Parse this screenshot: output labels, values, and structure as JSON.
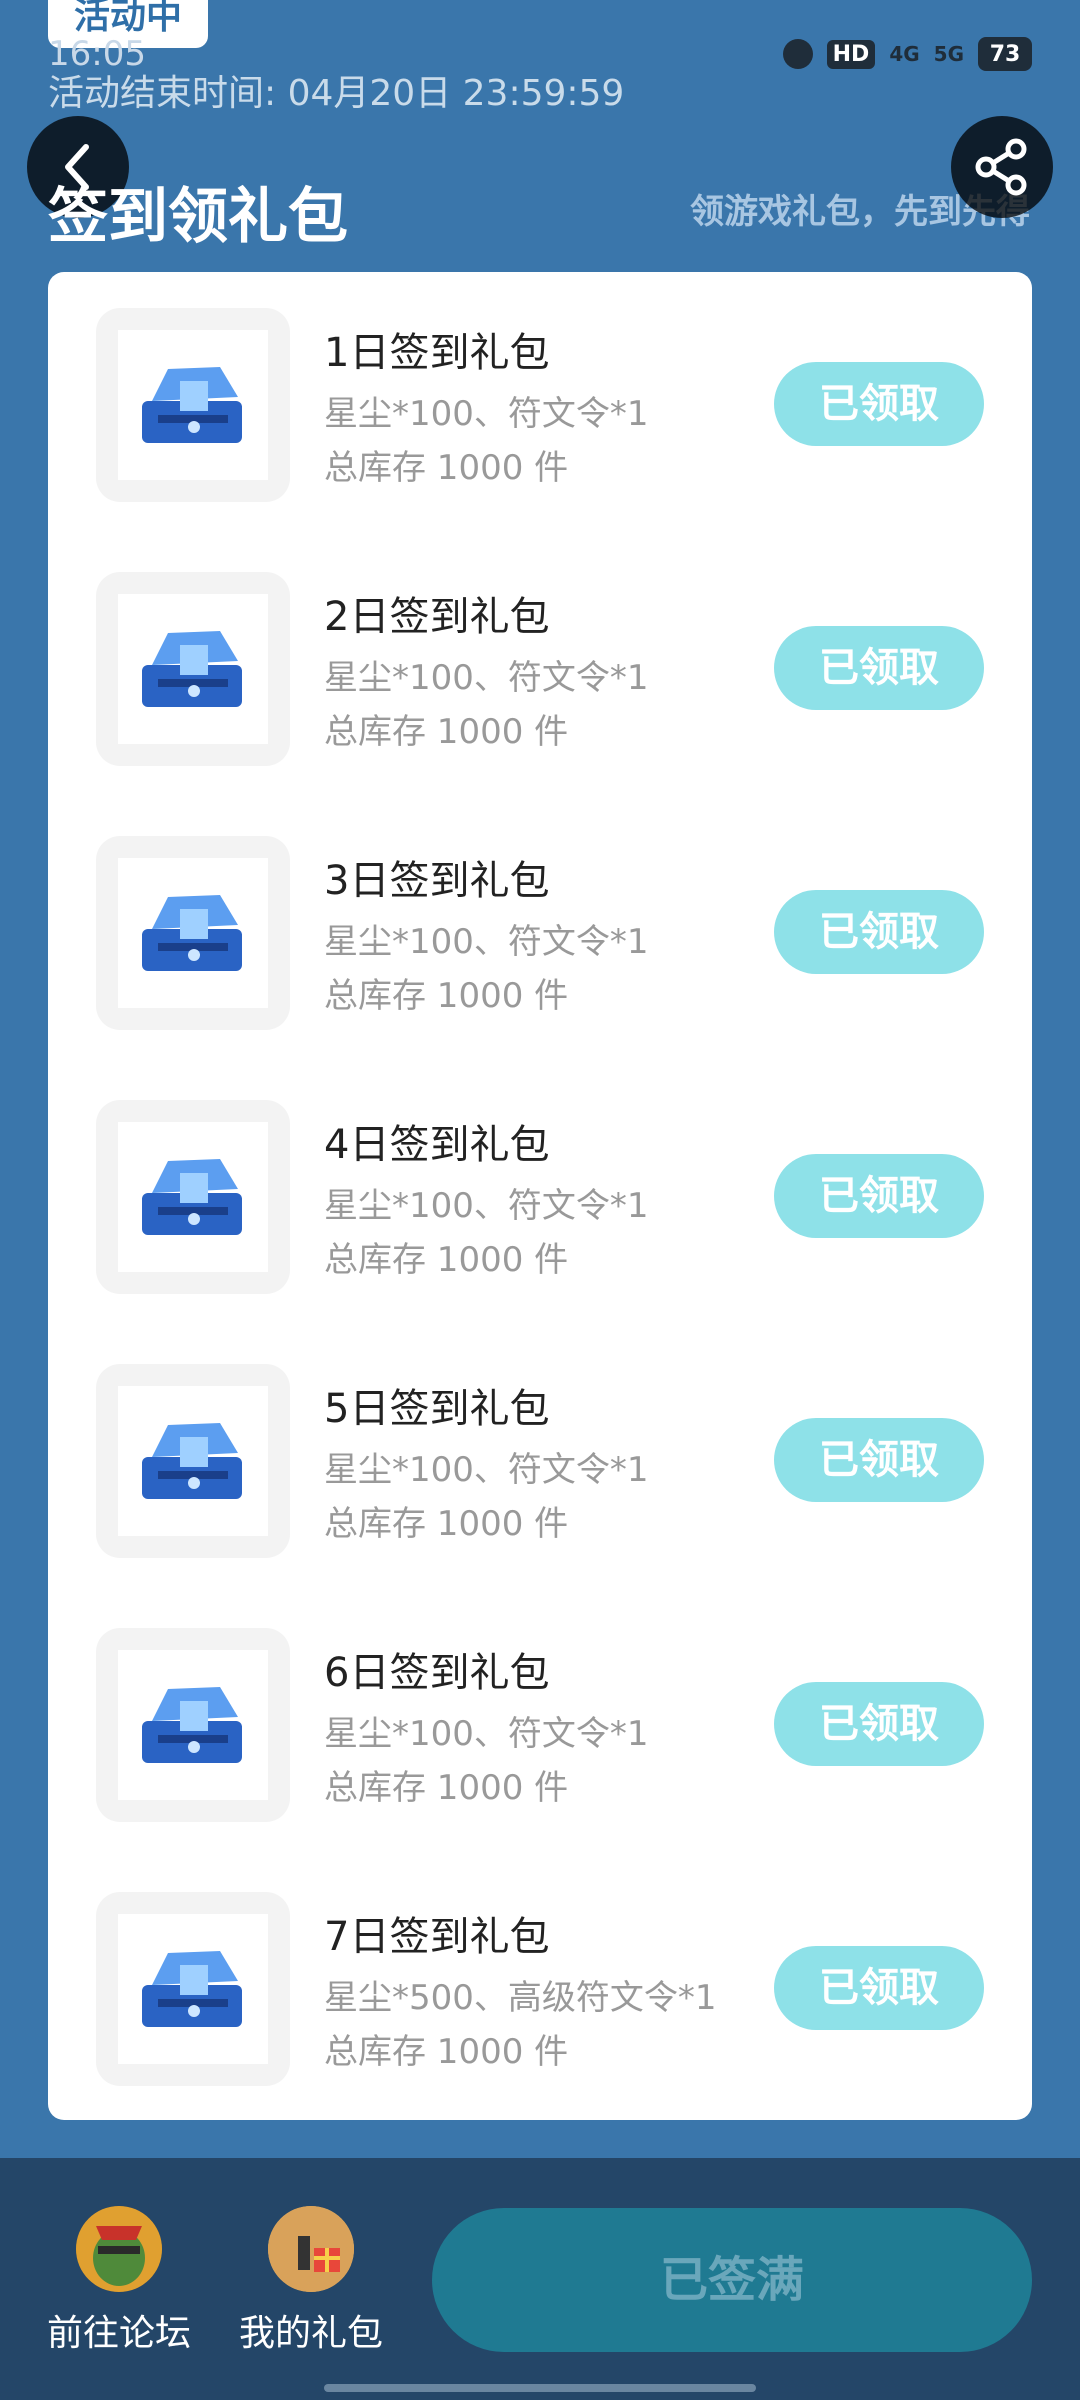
{
  "header": {
    "badge": "活动中",
    "time": "16:05",
    "battery": "73",
    "end_time": "活动结束时间: 04月20日 23:59:59",
    "title": "签到领礼包",
    "slogan": "领游戏礼包，先到先得"
  },
  "status_bar": {
    "hd": "HD",
    "net1": "4G",
    "net2": "5G"
  },
  "gifts": [
    {
      "name": "1日签到礼包",
      "desc": "星尘*100、符文令*1",
      "stock": "总库存 1000 件",
      "button": "已领取"
    },
    {
      "name": "2日签到礼包",
      "desc": "星尘*100、符文令*1",
      "stock": "总库存 1000 件",
      "button": "已领取"
    },
    {
      "name": "3日签到礼包",
      "desc": "星尘*100、符文令*1",
      "stock": "总库存 1000 件",
      "button": "已领取"
    },
    {
      "name": "4日签到礼包",
      "desc": "星尘*100、符文令*1",
      "stock": "总库存 1000 件",
      "button": "已领取"
    },
    {
      "name": "5日签到礼包",
      "desc": "星尘*100、符文令*1",
      "stock": "总库存 1000 件",
      "button": "已领取"
    },
    {
      "name": "6日签到礼包",
      "desc": "星尘*100、符文令*1",
      "stock": "总库存 1000 件",
      "button": "已领取"
    },
    {
      "name": "7日签到礼包",
      "desc": "星尘*500、高级符文令*1",
      "stock": "总库存 1000 件",
      "button": "已领取"
    }
  ],
  "bottom": {
    "forum_label": "前往论坛",
    "gifts_label": "我的礼包",
    "sign_button": "已签满"
  },
  "colors": {
    "background": "#3a76ab",
    "claimed_button": "#8ee1e8",
    "bottom_bar": "#244668",
    "sign_button": "#1f7a92"
  }
}
